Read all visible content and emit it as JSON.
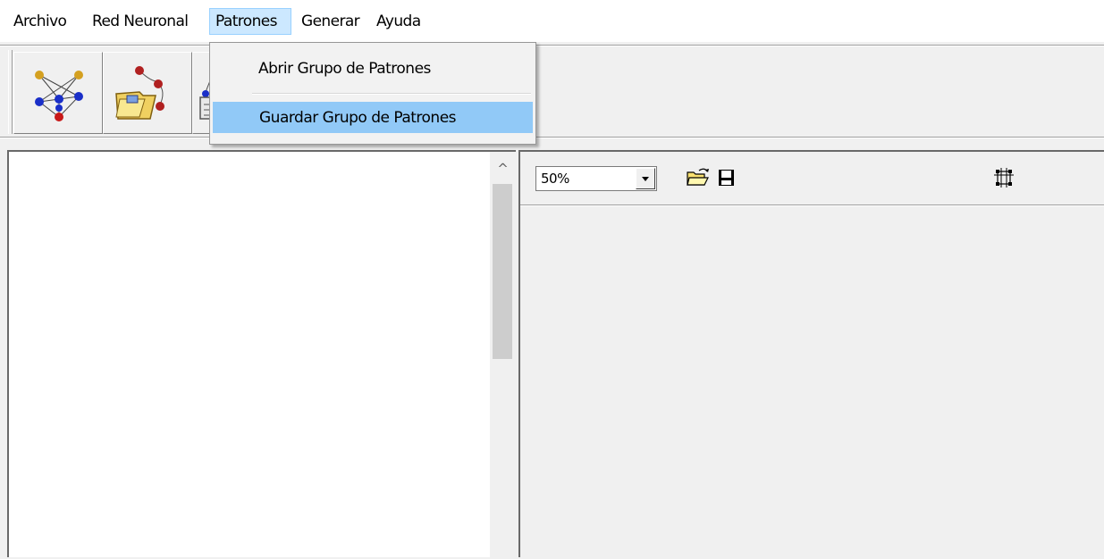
{
  "menubar": {
    "items": [
      "Archivo",
      "Red Neuronal",
      "Patrones",
      "Generar",
      "Ayuda"
    ],
    "active": "Patrones"
  },
  "toolbar": {
    "buttons": [
      {
        "icon": "neural-network-icon"
      },
      {
        "icon": "open-network-folder-icon"
      },
      {
        "icon": "save-network-icon"
      }
    ]
  },
  "patrones_menu": {
    "items": [
      {
        "label": "Abrir Grupo de Patrones",
        "highlighted": false
      },
      {
        "label": "Guardar Grupo de Patrones",
        "highlighted": true
      }
    ],
    "highlight_color": "#91c9f7"
  },
  "left_panel": {
    "scroll_up_glyph": "^"
  },
  "right_panel": {
    "zoom": {
      "value": "50%"
    },
    "buttons": [
      {
        "icon": "open-folder-icon"
      },
      {
        "icon": "save-disk-icon"
      },
      {
        "icon": "fit-selection-icon"
      }
    ]
  },
  "colors": {
    "menu_active_bg": "#cce8ff",
    "menu_highlight": "#91c9f7",
    "window_bg": "#f0f0f0"
  }
}
